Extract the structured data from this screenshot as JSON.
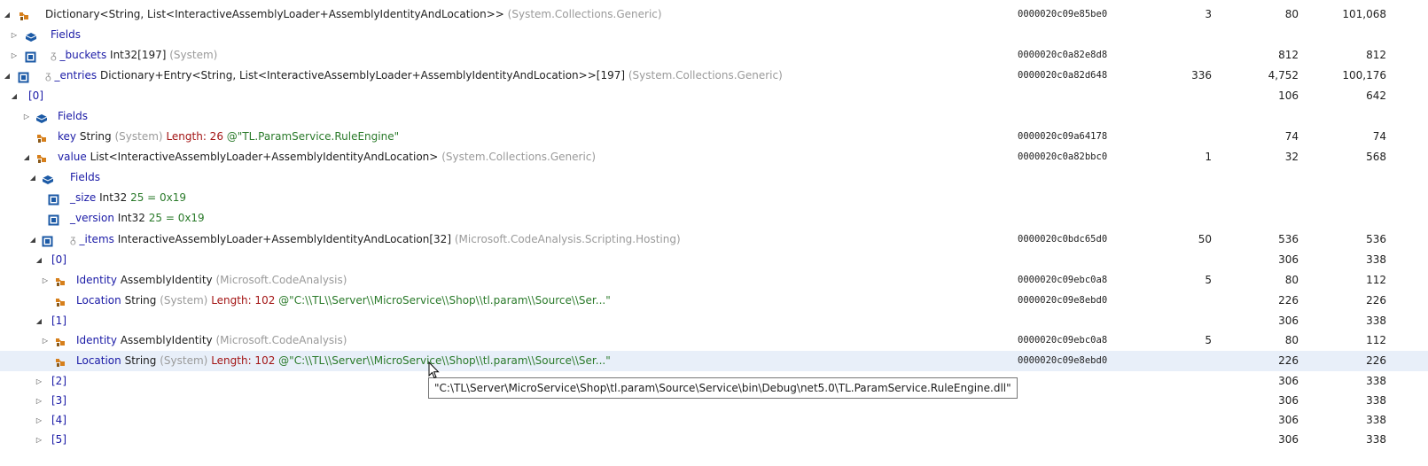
{
  "rows": [
    {
      "indent": 0,
      "toggle": "expanded",
      "icon": "object-icon",
      "prefix": "",
      "name": "",
      "type": "Dictionary<String, List<InteractiveAssemblyLoader+AssemblyIdentityAndLocation>>",
      "ns": "(System.Collections.Generic)",
      "extra": "",
      "extra_kind": "",
      "address": "0000020c09e85be0",
      "count": "3",
      "size": "80",
      "retained": "101,068",
      "selected": false
    },
    {
      "indent": 1,
      "toggle": "collapsed",
      "icon": "fields-icon",
      "prefix": "",
      "name": "Fields",
      "type": "",
      "ns": "",
      "extra": "",
      "extra_kind": "",
      "address": "",
      "count": "",
      "size": "",
      "retained": "",
      "selected": false
    },
    {
      "indent": 1,
      "toggle": "collapsed",
      "icon": "field-icon",
      "prefix": "ᵹ",
      "name": "_buckets",
      "type": "Int32[197]",
      "ns": "(System)",
      "extra": "",
      "extra_kind": "",
      "address": "0000020c0a82e8d8",
      "count": "",
      "size": "812",
      "retained": "812",
      "selected": false
    },
    {
      "indent": 0,
      "toggle": "expanded",
      "icon": "field-icon",
      "prefix": "ᵹ",
      "name": "_entries",
      "type": "Dictionary+Entry<String, List<InteractiveAssemblyLoader+AssemblyIdentityAndLocation>>[197]",
      "ns": "(System.Collections.Generic)",
      "extra": "",
      "extra_kind": "",
      "address": "0000020c0a82d648",
      "count": "336",
      "size": "4,752",
      "retained": "100,176",
      "selected": false
    },
    {
      "indent": 1,
      "toggle": "expanded",
      "icon": "",
      "prefix": "",
      "name": "[0]",
      "type": "",
      "ns": "",
      "extra": "",
      "extra_kind": "",
      "address": "",
      "count": "",
      "size": "106",
      "retained": "642",
      "selected": false
    },
    {
      "indent": 2,
      "toggle": "collapsed",
      "icon": "fields-icon",
      "prefix": "",
      "name": "Fields",
      "type": "",
      "ns": "",
      "extra": "",
      "extra_kind": "",
      "address": "",
      "count": "",
      "size": "",
      "retained": "",
      "selected": false
    },
    {
      "indent": 2,
      "toggle": "",
      "icon": "property-icon",
      "prefix": "",
      "name": "key",
      "type": "String",
      "ns": "(System)",
      "extra": "Length: 26  @\"TL.ParamService.RuleEngine\"",
      "extra_kind": "string",
      "address": "0000020c09a64178",
      "count": "",
      "size": "74",
      "retained": "74",
      "selected": false
    },
    {
      "indent": 2,
      "toggle": "expanded",
      "icon": "property-icon",
      "prefix": "",
      "name": "value",
      "type": "List<InteractiveAssemblyLoader+AssemblyIdentityAndLocation>",
      "ns": "(System.Collections.Generic)",
      "extra": "",
      "extra_kind": "",
      "address": "0000020c0a82bbc0",
      "count": "1",
      "size": "32",
      "retained": "568",
      "selected": false
    },
    {
      "indent": 3,
      "toggle": "expanded",
      "icon": "fields-icon",
      "prefix": "",
      "name": "Fields",
      "type": "",
      "ns": "",
      "extra": "",
      "extra_kind": "",
      "address": "",
      "count": "",
      "size": "",
      "retained": "",
      "selected": false
    },
    {
      "indent": 4,
      "toggle": "",
      "icon": "field-icon",
      "prefix": "",
      "name": "_size",
      "type": "Int32",
      "ns": "",
      "extra": "25 = 0x19",
      "extra_kind": "number",
      "address": "",
      "count": "",
      "size": "",
      "retained": "",
      "selected": false
    },
    {
      "indent": 4,
      "toggle": "",
      "icon": "field-icon",
      "prefix": "",
      "name": "_version",
      "type": "Int32",
      "ns": "",
      "extra": "25 = 0x19",
      "extra_kind": "number",
      "address": "",
      "count": "",
      "size": "",
      "retained": "",
      "selected": false
    },
    {
      "indent": 3,
      "toggle": "expanded",
      "icon": "field-icon",
      "prefix": "ᵹ",
      "name": "_items",
      "type": "InteractiveAssemblyLoader+AssemblyIdentityAndLocation[32]",
      "ns": "(Microsoft.CodeAnalysis.Scripting.Hosting)",
      "extra": "",
      "extra_kind": "",
      "address": "0000020c0bdc65d0",
      "count": "50",
      "size": "536",
      "retained": "536",
      "selected": false
    },
    {
      "indent": 4,
      "toggle": "expanded",
      "icon": "",
      "prefix": "",
      "name": "[0]",
      "type": "",
      "ns": "",
      "extra": "",
      "extra_kind": "",
      "address": "",
      "count": "",
      "size": "306",
      "retained": "338",
      "selected": false
    },
    {
      "indent": 5,
      "toggle": "collapsed",
      "icon": "property-icon",
      "prefix": "",
      "name": "Identity",
      "type": "AssemblyIdentity",
      "ns": "(Microsoft.CodeAnalysis)",
      "extra": "",
      "extra_kind": "",
      "address": "0000020c09ebc0a8",
      "count": "5",
      "size": "80",
      "retained": "112",
      "selected": false
    },
    {
      "indent": 5,
      "toggle": "",
      "icon": "property-icon",
      "prefix": "",
      "name": "Location",
      "type": "String",
      "ns": "(System)",
      "extra": "Length: 102  @\"C:\\\\TL\\\\Server\\\\MicroService\\\\Shop\\\\tl.param\\\\Source\\\\Ser...\"",
      "extra_kind": "string",
      "address": "0000020c09e8ebd0",
      "count": "",
      "size": "226",
      "retained": "226",
      "selected": false
    },
    {
      "indent": 4,
      "toggle": "expanded",
      "icon": "",
      "prefix": "",
      "name": "[1]",
      "type": "",
      "ns": "",
      "extra": "",
      "extra_kind": "",
      "address": "",
      "count": "",
      "size": "306",
      "retained": "338",
      "selected": false
    },
    {
      "indent": 5,
      "toggle": "collapsed",
      "icon": "property-icon",
      "prefix": "",
      "name": "Identity",
      "type": "AssemblyIdentity",
      "ns": "(Microsoft.CodeAnalysis)",
      "extra": "",
      "extra_kind": "",
      "address": "0000020c09ebc0a8",
      "count": "5",
      "size": "80",
      "retained": "112",
      "selected": false
    },
    {
      "indent": 5,
      "toggle": "",
      "icon": "property-icon",
      "prefix": "",
      "name": "Location",
      "type": "String",
      "ns": "(System)",
      "extra": "Length: 102  @\"C:\\\\TL\\\\Server\\\\MicroService\\\\Shop\\\\tl.param\\\\Source\\\\Ser...\"",
      "extra_kind": "string",
      "address": "0000020c09e8ebd0",
      "count": "",
      "size": "226",
      "retained": "226",
      "selected": true
    },
    {
      "indent": 4,
      "toggle": "collapsed",
      "icon": "",
      "prefix": "",
      "name": "[2]",
      "type": "",
      "ns": "",
      "extra": "",
      "extra_kind": "",
      "address": "",
      "count": "",
      "size": "306",
      "retained": "338",
      "selected": false
    },
    {
      "indent": 4,
      "toggle": "collapsed",
      "icon": "",
      "prefix": "",
      "name": "[3]",
      "type": "",
      "ns": "",
      "extra": "",
      "extra_kind": "",
      "address": "",
      "count": "",
      "size": "306",
      "retained": "338",
      "selected": false
    },
    {
      "indent": 4,
      "toggle": "collapsed",
      "icon": "",
      "prefix": "",
      "name": "[4]",
      "type": "",
      "ns": "",
      "extra": "",
      "extra_kind": "",
      "address": "",
      "count": "",
      "size": "306",
      "retained": "338",
      "selected": false
    },
    {
      "indent": 4,
      "toggle": "collapsed",
      "icon": "",
      "prefix": "",
      "name": "[5]",
      "type": "",
      "ns": "",
      "extra": "",
      "extra_kind": "",
      "address": "",
      "count": "",
      "size": "306",
      "retained": "338",
      "selected": false
    }
  ],
  "tooltip": {
    "text": "\"C:\\TL\\Server\\MicroService\\Shop\\tl.param\\Source\\Service\\bin\\Debug\\net5.0\\TL.ParamService.RuleEngine.dll\""
  },
  "colors": {
    "name": "#1a1aa6",
    "namespace": "#9a9a9a",
    "length": "#a31515",
    "string": "#2a7a2a",
    "icon_orange": "#d67f1b",
    "icon_blue": "#1c5aa6",
    "selection": "#e8eff9"
  }
}
